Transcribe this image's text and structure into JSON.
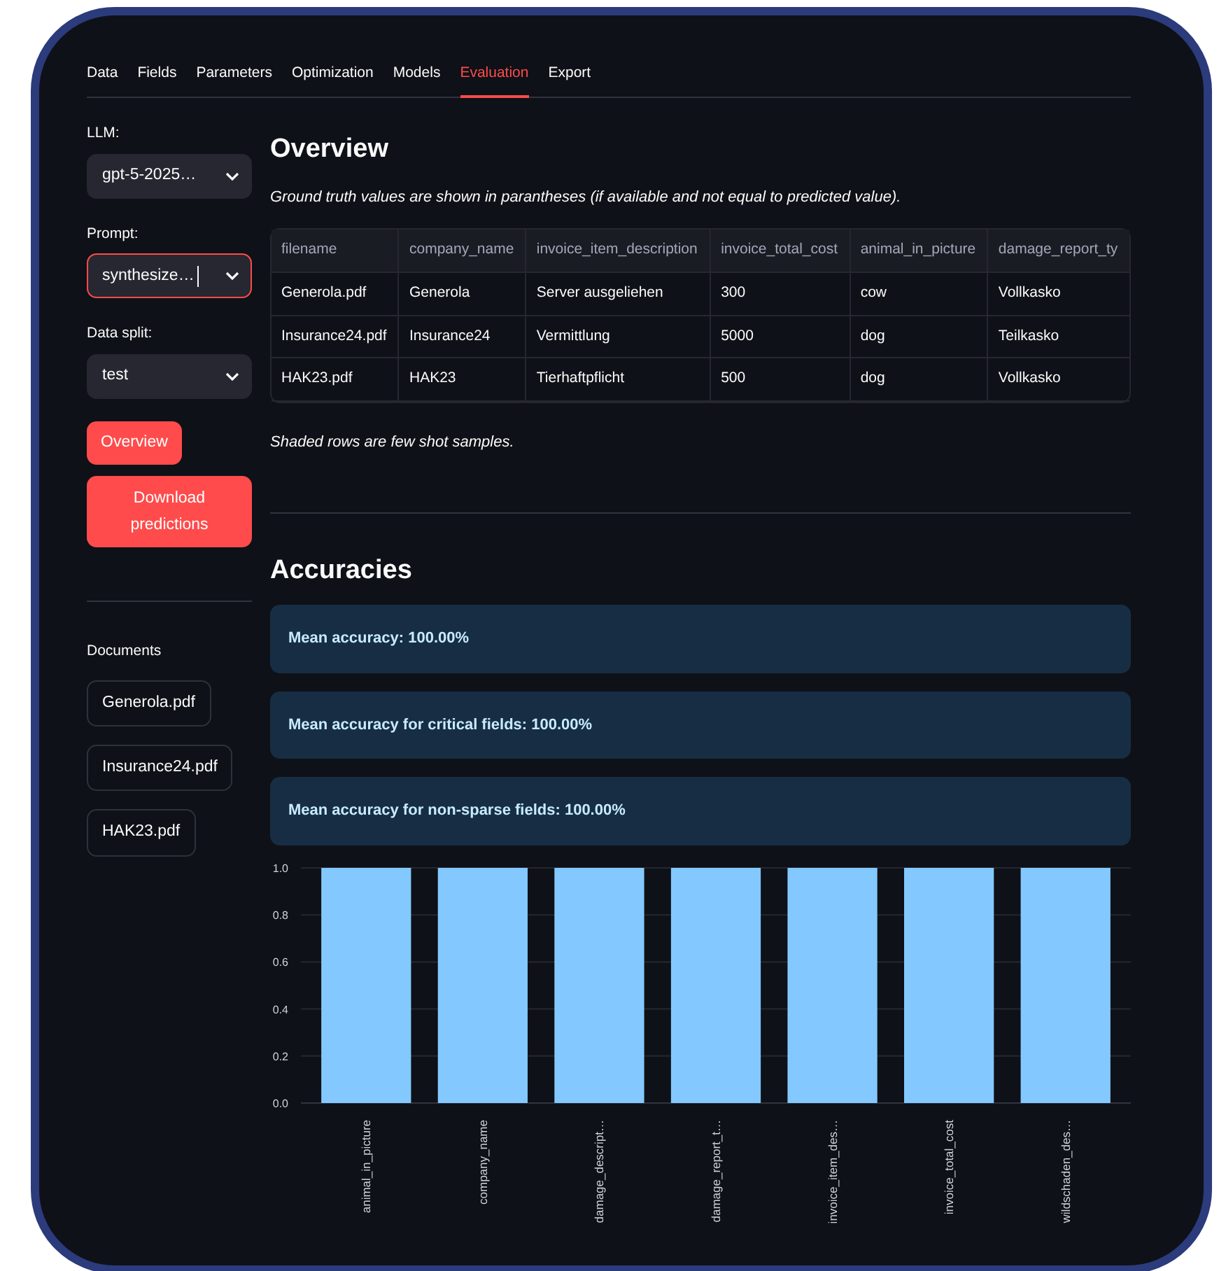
{
  "tabs": [
    {
      "label": "Data",
      "selected": false
    },
    {
      "label": "Fields",
      "selected": false
    },
    {
      "label": "Parameters",
      "selected": false
    },
    {
      "label": "Optimization",
      "selected": false
    },
    {
      "label": "Models",
      "selected": false
    },
    {
      "label": "Evaluation",
      "selected": true
    },
    {
      "label": "Export",
      "selected": false
    }
  ],
  "sidebar": {
    "selects": [
      {
        "label": "LLM:",
        "value": "gpt-5-2025…",
        "focused": false
      },
      {
        "label": "Prompt:",
        "value": "synthesize…",
        "focused": true
      },
      {
        "label": "Data split:",
        "value": "test",
        "focused": false
      }
    ],
    "buttons": [
      "Overview",
      "Download predictions"
    ],
    "documents_label": "Documents",
    "documents": [
      "Generola.pdf",
      "Insurance24.pdf",
      "HAK23.pdf"
    ]
  },
  "overview": {
    "title": "Overview",
    "note": "Ground truth values are shown in parantheses (if available and not equal to predicted value).",
    "table": {
      "columns": [
        "filename",
        "company_name",
        "invoice_item_description",
        "invoice_total_cost",
        "animal_in_picture",
        "damage_report_ty"
      ],
      "rows": [
        [
          "Generola.pdf",
          "Generola",
          "Server ausgeliehen",
          "300",
          "cow",
          "Vollkasko"
        ],
        [
          "Insurance24.pdf",
          "Insurance24",
          "Vermittlung",
          "5000",
          "dog",
          "Teilkasko"
        ],
        [
          "HAK23.pdf",
          "HAK23",
          "Tierhaftpflicht",
          "500",
          "dog",
          "Vollkasko"
        ]
      ]
    },
    "footnote": "Shaded rows are few shot samples."
  },
  "accuracies": {
    "title": "Accuracies",
    "metrics": [
      "Mean accuracy: 100.00%",
      "Mean accuracy for critical fields: 100.00%",
      "Mean accuracy for non-sparse fields: 100.00%"
    ],
    "chart_data": {
      "type": "bar",
      "categories": [
        "animal_in_picture",
        "company_name",
        "damage_descript…",
        "damage_report_t…",
        "invoice_item_des…",
        "invoice_total_cost",
        "wildschaden_des…"
      ],
      "grid": true,
      "series": [
        {
          "color": "#83c9ff",
          "values": [
            1.0,
            1.0,
            1.0,
            1.0,
            1.0,
            1.0,
            1.0
          ]
        }
      ],
      "ylim": [
        0,
        1
      ],
      "yticks": [
        {
          "value": 0,
          "label": "0.0"
        },
        {
          "value": 0.2,
          "label": "0.2"
        },
        {
          "value": 0.4,
          "label": "0.4"
        },
        {
          "value": 0.6,
          "label": "0.6"
        },
        {
          "value": 0.8,
          "label": "0.8"
        },
        {
          "value": 1,
          "label": "1.0"
        }
      ]
    }
  }
}
